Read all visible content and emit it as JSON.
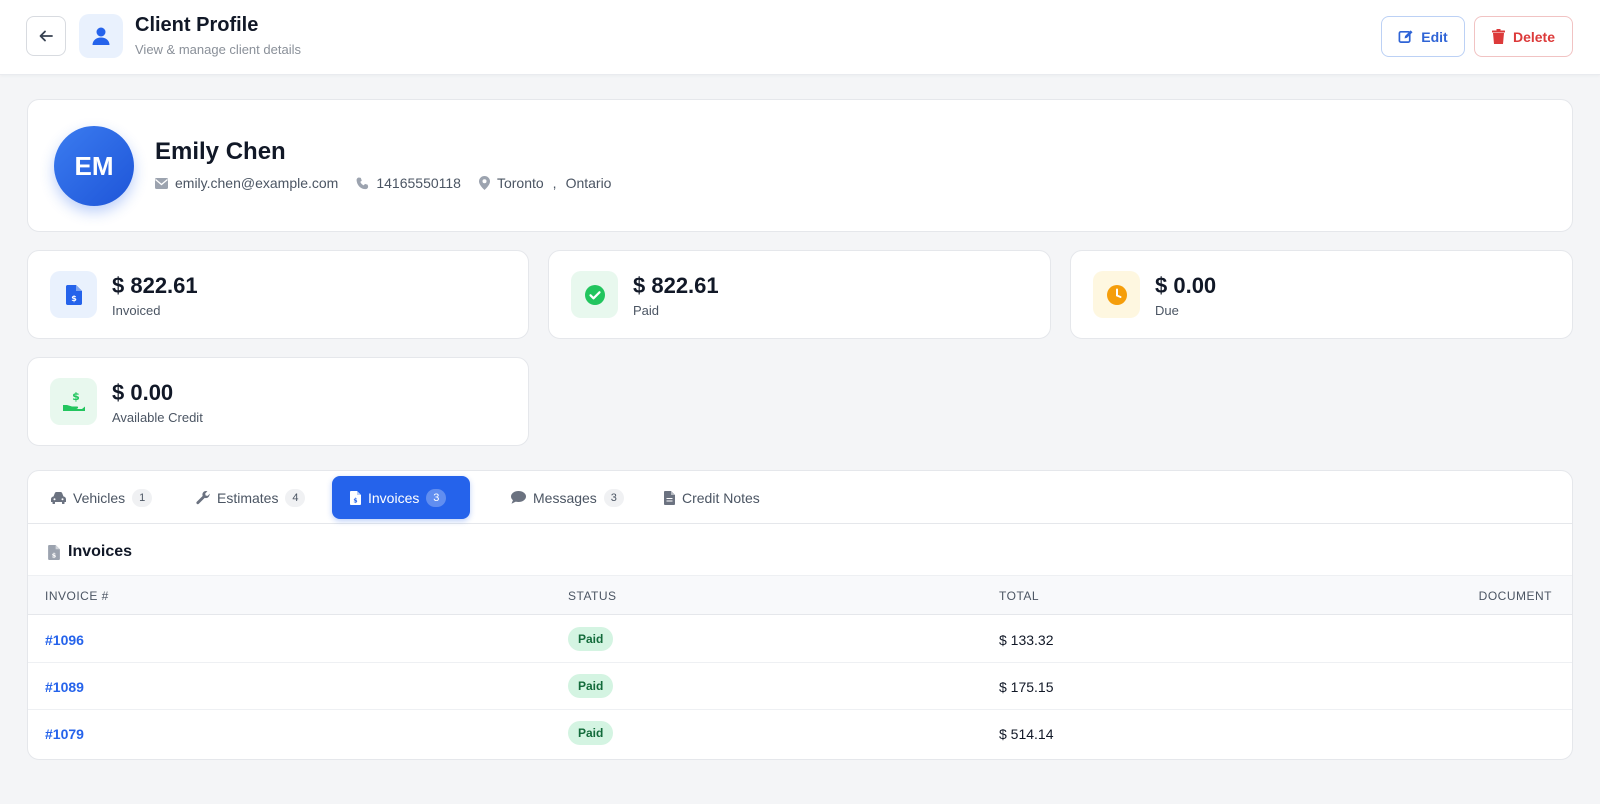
{
  "header": {
    "title": "Client Profile",
    "subtitle": "View & manage client details",
    "edit_label": "Edit",
    "delete_label": "Delete"
  },
  "client": {
    "initials": "EM",
    "name": "Emily Chen",
    "email": "emily.chen@example.com",
    "phone": "14165550118",
    "city": "Toronto",
    "separator": ",",
    "province": "Ontario"
  },
  "stats": [
    {
      "value": "$ 822.61",
      "label": "Invoiced",
      "icon": "invoice-dollar-icon",
      "color": "#2563eb",
      "bg": "#e9f1fd"
    },
    {
      "value": "$ 822.61",
      "label": "Paid",
      "icon": "check-circle-icon",
      "color": "#22c55e",
      "bg": "#e8f8ee"
    },
    {
      "value": "$ 0.00",
      "label": "Due",
      "icon": "clock-icon",
      "color": "#f59e0b",
      "bg": "#fef7e0"
    },
    {
      "value": "$ 0.00",
      "label": "Available Credit",
      "icon": "hand-dollar-icon",
      "color": "#22c55e",
      "bg": "#e8f8ee"
    }
  ],
  "tabs": [
    {
      "label": "Vehicles",
      "count": "1",
      "icon": "car-icon",
      "active": false
    },
    {
      "label": "Estimates",
      "count": "4",
      "icon": "wrench-icon",
      "active": false
    },
    {
      "label": "Invoices",
      "count": "3",
      "icon": "invoice-icon",
      "active": true
    },
    {
      "label": "Messages",
      "count": "3",
      "icon": "comment-icon",
      "active": false
    },
    {
      "label": "Credit Notes",
      "count": "",
      "icon": "document-icon",
      "active": false
    }
  ],
  "invoices_section": {
    "title": "Invoices",
    "columns": [
      "INVOICE #",
      "STATUS",
      "TOTAL",
      "DOCUMENT"
    ],
    "rows": [
      {
        "number": "#1096",
        "status": "Paid",
        "total": "$ 133.32"
      },
      {
        "number": "#1089",
        "status": "Paid",
        "total": "$ 175.15"
      },
      {
        "number": "#1079",
        "status": "Paid",
        "total": "$ 514.14"
      }
    ]
  },
  "colors": {
    "accent": "#2563eb",
    "danger": "#dc3a3a",
    "paid_badge_bg": "#d4f4e2",
    "paid_badge_text": "#136b3b"
  }
}
